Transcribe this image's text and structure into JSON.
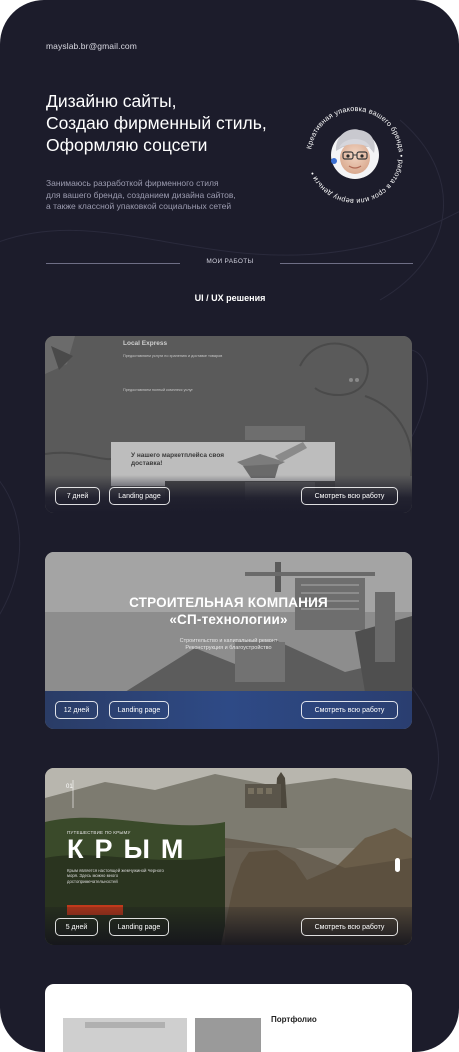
{
  "header": {
    "email": "mayslab.br@gmail.com",
    "headline": [
      "Дизайню сайты,",
      "Создаю фирменный стиль,",
      "Оформляю соцсети"
    ],
    "description": [
      "Занимаюсь разработкой фирменного стиля",
      "для вашего бренда, созданием дизайна сайтов,",
      "а также классной упаковкой социальных сетей"
    ],
    "badge_text": "Креативная упаковка вашего бренда • работа в срок или верну деньги •"
  },
  "works": {
    "section_label": "МОИ РАБОТЫ",
    "category_title": "UI / UX решения",
    "cards": [
      {
        "days": "7 дней",
        "type": "Landing page",
        "cta": "Смотреть всю работу",
        "preview": {
          "brand": "Local Express",
          "text_a": "Предоставляем услуги по хранению и доставке товаров",
          "text_b": "Предоставляем полный комплекс услуг",
          "promo": "У нашего маркетплейса своя доставка!"
        }
      },
      {
        "days": "12 дней",
        "type": "Landing page",
        "cta": "Смотреть всю работу",
        "preview": {
          "title_line1": "СТРОИТЕЛЬНАЯ КОМПАНИЯ",
          "title_line2": "«СП-технологии»",
          "subtitle_line1": "Строительство и капитальный ремонт",
          "subtitle_line2": "Реконструкция и благоустройство"
        }
      },
      {
        "days": "5 дней",
        "type": "Landing page",
        "cta": "Смотреть всю работу",
        "preview": {
          "number": "01",
          "kicker": "ПУТЕШЕСТВИЕ ПО КРЫМУ",
          "title": "КРЫМ",
          "desc": "Крым является настоящей жемчужиной Черного моря. Здесь можно много достопримечательностей"
        }
      }
    ],
    "next_card": {
      "title": "Портфолио"
    }
  },
  "colors": {
    "background": "#1c1c2b",
    "card2_accent": "#2e4a86",
    "card3_accent": "#c0391b"
  }
}
